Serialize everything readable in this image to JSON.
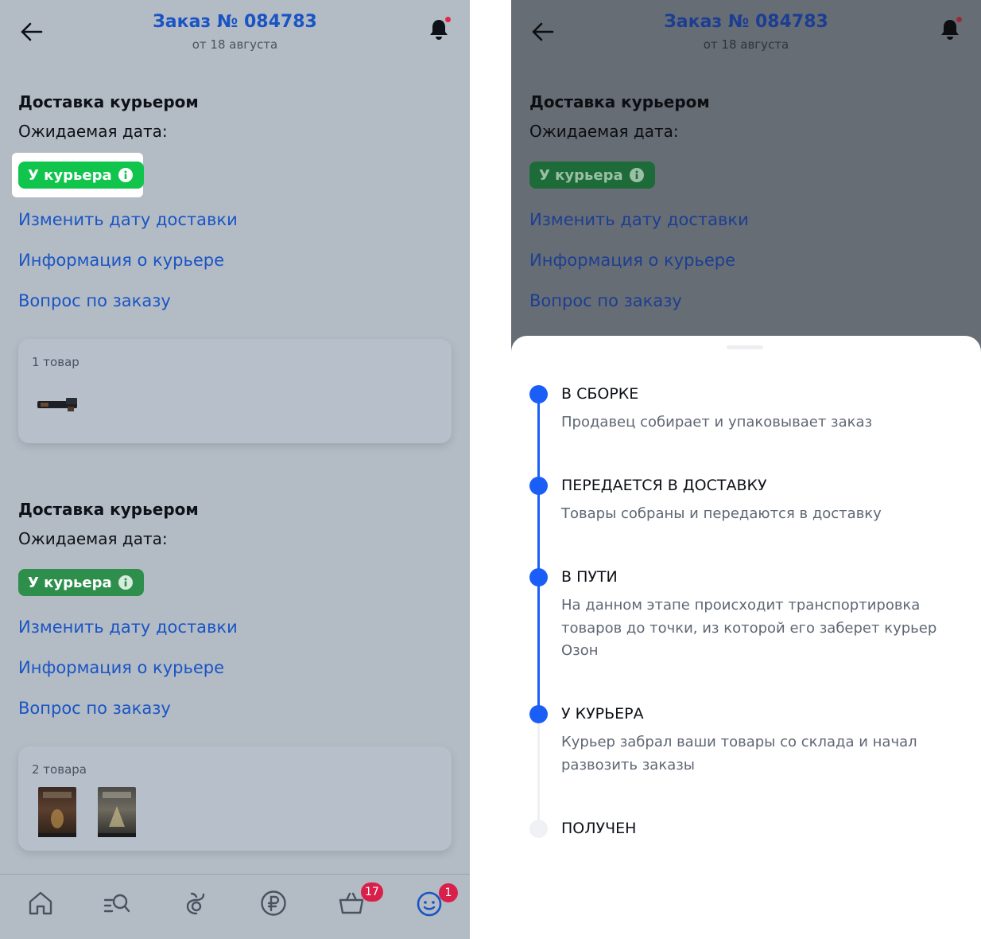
{
  "order": {
    "title": "Заказ № 084783",
    "subtitle": "от 18 августа"
  },
  "shipments": [
    {
      "delivery_title": "Доставка курьером",
      "expected_date_label": "Ожидаемая дата:",
      "status_chip": "У курьера",
      "links": [
        "Изменить дату доставки",
        "Информация о курьере",
        "Вопрос по заказу"
      ],
      "items_count": "1 товар"
    },
    {
      "delivery_title": "Доставка курьером",
      "expected_date_label": "Ожидаемая дата:",
      "status_chip": "У курьера",
      "links": [
        "Изменить дату доставки",
        "Информация о курьере",
        "Вопрос по заказу"
      ],
      "items_count": "2 товара"
    }
  ],
  "tabbar": {
    "tabs": [
      "home-icon",
      "catalog-search-icon",
      "fresh-icon",
      "ruble-icon",
      "cart-icon",
      "profile-icon"
    ],
    "cart_badge": "17",
    "profile_badge": "1"
  },
  "status_sheet": {
    "steps": [
      {
        "title": "В СБОРКЕ",
        "description": "Продавец собирает и упаковывает заказ",
        "done": true
      },
      {
        "title": "ПЕРЕДАЕТСЯ В ДОСТАВКУ",
        "description": "Товары собраны и передаются в доставку",
        "done": true
      },
      {
        "title": "В ПУТИ",
        "description": "На данном этапе происходит транспортировка товаров до точки, из которой его заберет курьер Озон",
        "done": true
      },
      {
        "title": "У КУРЬЕРА",
        "description": "Курьер забрал ваши товары со склада и начал развозить заказы",
        "done": true
      },
      {
        "title": "ПОЛУЧЕН",
        "description": "",
        "done": false
      }
    ]
  },
  "colors": {
    "accent_blue": "#1a54c4",
    "status_green": "#10c44c",
    "timeline_blue": "#1b5ef7",
    "badge_red": "#d8204a"
  }
}
